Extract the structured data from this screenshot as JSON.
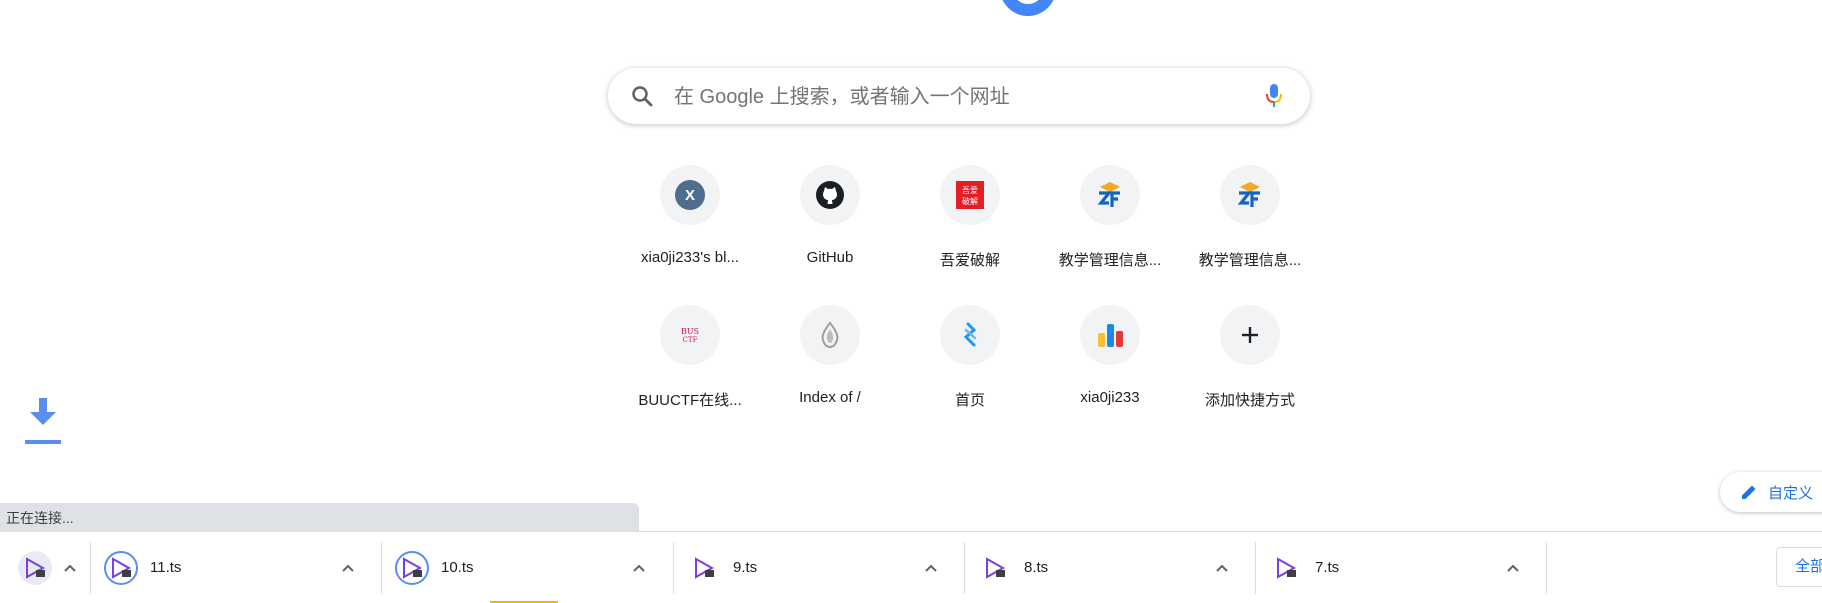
{
  "search": {
    "placeholder": "在 Google 上搜索，或者输入一个网址"
  },
  "shortcuts": [
    {
      "title": "xia0ji233's bl...",
      "icon": "letter-x-icon",
      "letter": "X"
    },
    {
      "title": "GitHub",
      "icon": "github-icon"
    },
    {
      "title": "吾爱破解",
      "icon": "52pojie-icon",
      "text": "吾爱破解"
    },
    {
      "title": "教学管理信息...",
      "icon": "zf-logo-icon"
    },
    {
      "title": "教学管理信息...",
      "icon": "zf-logo-icon"
    },
    {
      "title": "BUUCTF在线...",
      "icon": "buuctf-icon",
      "text": "BUU CTF"
    },
    {
      "title": "Index of /",
      "icon": "drop-icon"
    },
    {
      "title": "首页",
      "icon": "blue-logo-icon"
    },
    {
      "title": "xia0ji233",
      "icon": "bar-chart-icon"
    },
    {
      "title": "添加快捷方式",
      "icon": "plus-icon"
    }
  ],
  "customize": {
    "label": "自定义"
  },
  "status": {
    "text": "正在连接..."
  },
  "downloads": {
    "items": [
      {
        "name": "",
        "icon": "video-file-icon"
      },
      {
        "name": "11.ts",
        "icon": "video-file-icon"
      },
      {
        "name": "10.ts",
        "icon": "video-file-icon"
      },
      {
        "name": "9.ts",
        "icon": "video-file-icon"
      },
      {
        "name": "8.ts",
        "icon": "video-file-icon"
      },
      {
        "name": "7.ts",
        "icon": "video-file-icon"
      }
    ],
    "show_all": "全部"
  },
  "colors": {
    "accent": "#1a73e8",
    "google_blue": "#4285f4",
    "video_icon": "#7b3fe4",
    "status_bar_bg": "#dee1e6"
  }
}
